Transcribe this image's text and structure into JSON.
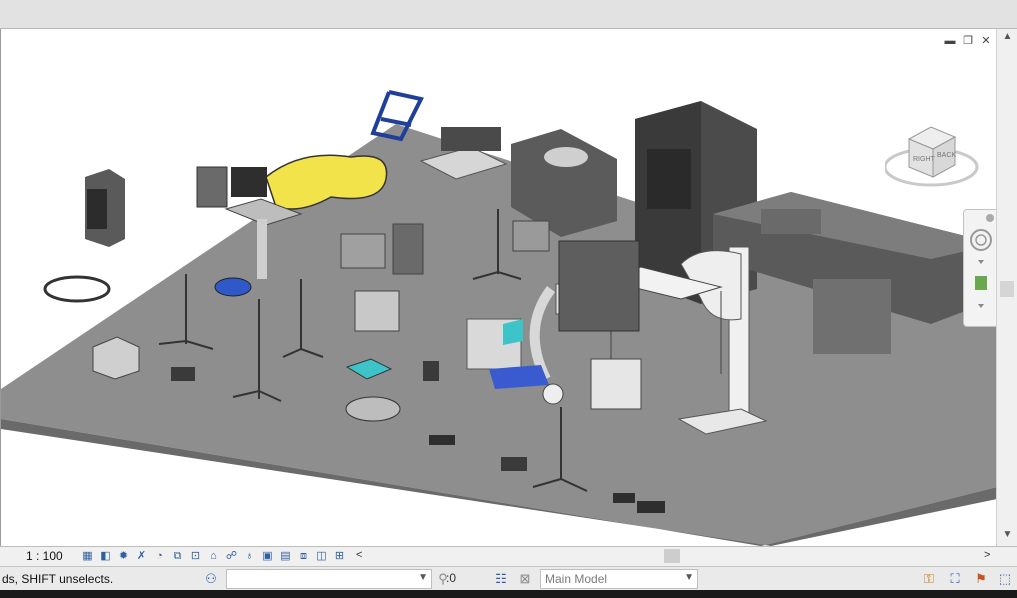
{
  "window": {
    "controls": {
      "minimize": "▬",
      "restore": "❐",
      "close": "✕"
    }
  },
  "viewport": {
    "description_icons": [
      "view-cube-icon",
      "navigation-bar-icon"
    ],
    "viewcube": {
      "right_label": "RIGHT",
      "back_label": "BACK"
    }
  },
  "view_control": {
    "scale": "1 : 100",
    "left_arrow": "<",
    "right_arrow": ">"
  },
  "status": {
    "message": "ds, SHIFT unselects.",
    "editable_count": ":0",
    "model_select": "Main Model",
    "workset_value": ""
  },
  "colors": {
    "floor": "#8c8c8c",
    "accent_yellow": "#f2e34a",
    "accent_blue": "#2f59c8",
    "accent_teal": "#3cc4c8"
  }
}
